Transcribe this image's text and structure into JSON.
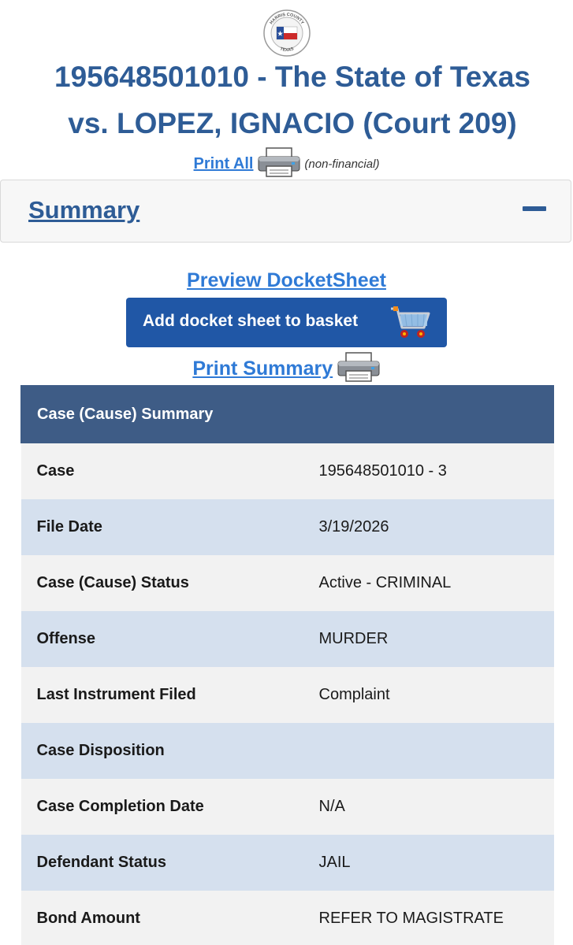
{
  "seal": {
    "top_text": "HARRIS COUNTY",
    "bottom_text": "TEXAS"
  },
  "header": {
    "title_line1": "195648501010 - The State of Texas",
    "title_line2": "vs. LOPEZ, IGNACIO (Court 209)"
  },
  "print_all": {
    "label": "Print All",
    "note": "(non-financial)"
  },
  "summary_panel": {
    "title": "Summary",
    "expanded": true
  },
  "actions": {
    "preview_docket": "Preview DocketSheet",
    "add_to_basket": "Add docket sheet to basket",
    "print_summary": "Print Summary"
  },
  "table": {
    "header": "Case (Cause) Summary",
    "rows": [
      {
        "label": "Case",
        "value": "195648501010 - 3"
      },
      {
        "label": "File Date",
        "value": "3/19/2026"
      },
      {
        "label": "Case (Cause) Status",
        "value": "Active - CRIMINAL"
      },
      {
        "label": "Offense",
        "value": "MURDER"
      },
      {
        "label": "Last Instrument Filed",
        "value": "Complaint"
      },
      {
        "label": "Case Disposition",
        "value": ""
      },
      {
        "label": "Case Completion Date",
        "value": "N/A"
      },
      {
        "label": "Defendant Status",
        "value": "JAIL"
      },
      {
        "label": "Bond Amount",
        "value": "REFER TO MAGISTRATE"
      }
    ]
  },
  "colors": {
    "title": "#2e5c96",
    "link": "#2f7ad6",
    "button": "#2057a6",
    "table_header": "#3e5c86",
    "row_odd": "#f2f2f2",
    "row_even": "#d5e0ee"
  }
}
